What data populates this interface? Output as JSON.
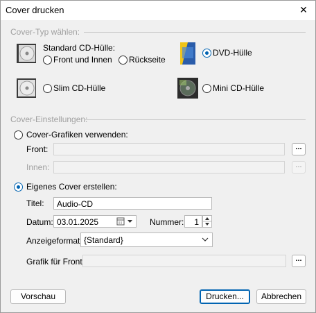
{
  "window": {
    "title": "Cover drucken",
    "close_glyph": "✕"
  },
  "cover_type": {
    "group_label": "Cover-Typ wählen:",
    "standard_label": "Standard CD-Hülle:",
    "front_inside": "Front und Innen",
    "back": "Rückseite",
    "dvd": "DVD-Hülle",
    "slim": "Slim CD-Hülle",
    "mini": "Mini CD-Hülle",
    "selected": "dvd"
  },
  "settings": {
    "group_label": "Cover-Einstellungen:",
    "use_graphics_label": "Cover-Grafiken verwenden:",
    "front_label": "Front:",
    "front_value": "",
    "inside_label": "Innen:",
    "inside_value": "",
    "own_cover_label": "Eigenes Cover erstellen:",
    "title_label": "Titel:",
    "title_value": "Audio-CD",
    "date_label": "Datum:",
    "date_value": "03.01.2025",
    "number_label": "Nummer:",
    "number_value": "1",
    "format_label": "Anzeigeformat:",
    "format_value": "{Standard}",
    "graphic_front_label": "Grafik für Front:",
    "graphic_front_value": "",
    "browse_glyph": "..."
  },
  "buttons": {
    "preview": "Vorschau",
    "print": "Drucken...",
    "cancel": "Abbrechen"
  }
}
